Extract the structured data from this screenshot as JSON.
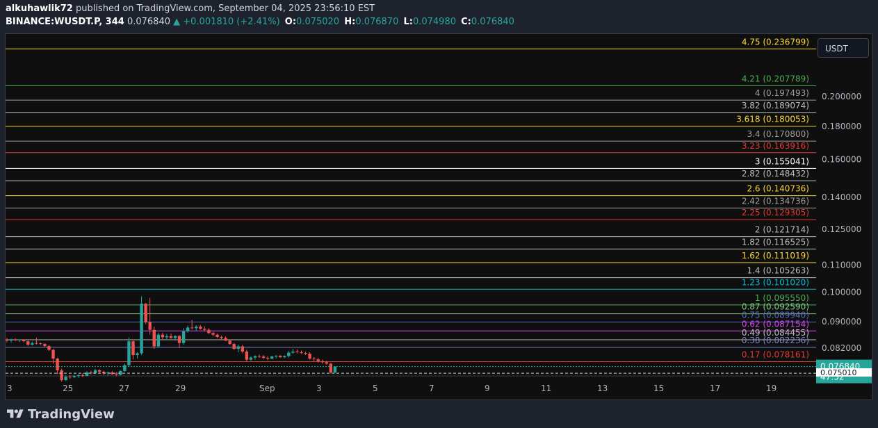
{
  "header": {
    "user": "alkuhawlik72",
    "published": " published on TradingView.com, September 04, 2025 23:56:10 EST",
    "symbol": "BINANCE:WUSDT.P, 344",
    "price": "0.076840",
    "change": "▲ +0.001810 (+2.41%)",
    "o_label": "O:",
    "o_value": "0.075020",
    "h_label": "H:",
    "h_value": "0.076870",
    "l_label": "L:",
    "l_value": "0.074980",
    "c_label": "C:",
    "c_value": "0.076840"
  },
  "currency_button": "USDT",
  "footer": {
    "brand": "TradingView"
  },
  "chart_data": {
    "type": "candlestick",
    "price_scale_labels": [
      "0.200000",
      "0.180000",
      "0.160000",
      "0.140000",
      "0.125000",
      "0.110000",
      "0.100000",
      "0.090000",
      "0.082000"
    ],
    "current_price_label": "0.076840",
    "countdown_label": "47:52",
    "low_marker_label": "0.075010",
    "x_tick_labels": [
      "3",
      "25",
      "27",
      "29",
      "Sep",
      "3",
      "5",
      "7",
      "9",
      "11",
      "13",
      "15",
      "17",
      "19"
    ],
    "fib_levels": [
      {
        "label": "4.75 (0.236799)",
        "value": 0.236799,
        "color": "#fdd835"
      },
      {
        "label": "4.21 (0.207789)",
        "value": 0.207789,
        "color": "#4caf50"
      },
      {
        "label": "4 (0.197493)",
        "value": 0.197493,
        "color": "#9e9e9e"
      },
      {
        "label": "3.82 (0.189074)",
        "value": 0.189074,
        "color": "#bdbdbd"
      },
      {
        "label": "3.618 (0.180053)",
        "value": 0.180053,
        "color": "#fdd835"
      },
      {
        "label": "3.4 (0.170800)",
        "value": 0.1708,
        "color": "#9e9e9e"
      },
      {
        "label": "3.23 (0.163916)",
        "value": 0.163916,
        "color": "#e53935"
      },
      {
        "label": "3 (0.155041)",
        "value": 0.155041,
        "color": "#ffffff"
      },
      {
        "label": "2.82 (0.148432)",
        "value": 0.148432,
        "color": "#bdbdbd"
      },
      {
        "label": "2.6 (0.140736)",
        "value": 0.140736,
        "color": "#fdd835"
      },
      {
        "label": "2.42 (0.134736)",
        "value": 0.134736,
        "color": "#9e9e9e"
      },
      {
        "label": "2.25 (0.129305)",
        "value": 0.129305,
        "color": "#e53935"
      },
      {
        "label": "2 (0.121714)",
        "value": 0.121714,
        "color": "#bdbdbd"
      },
      {
        "label": "1.82 (0.116525)",
        "value": 0.116525,
        "color": "#bdbdbd"
      },
      {
        "label": "1.62 (0.111019)",
        "value": 0.111019,
        "color": "#fdd835"
      },
      {
        "label": "1.4 (0.105263)",
        "value": 0.105263,
        "color": "#bdbdbd"
      },
      {
        "label": "1.23 (0.101020)",
        "value": 0.10102,
        "color": "#00bcd4"
      },
      {
        "label": "1 (0.095550)",
        "value": 0.09555,
        "color": "#4caf50"
      },
      {
        "label": "0.87 (0.092590)",
        "value": 0.09259,
        "color": "#81c784"
      },
      {
        "label": "0.75 (0.089940)",
        "value": 0.08994,
        "color": "#5c6bc0"
      },
      {
        "label": "0.62 (0.087154)",
        "value": 0.087154,
        "color": "#e040fb"
      },
      {
        "label": "0.49 (0.084455)",
        "value": 0.084455,
        "color": "#bdbdbd"
      },
      {
        "label": "0.38 (0.082236)",
        "value": 0.082236,
        "color": "#7986cb"
      },
      {
        "label": "0.17 (0.078161)",
        "value": 0.078161,
        "color": "#e53935"
      }
    ],
    "candles": [
      [
        0.0845,
        0.085,
        0.0837,
        0.0842
      ],
      [
        0.0842,
        0.0848,
        0.0836,
        0.0846
      ],
      [
        0.0846,
        0.0849,
        0.084,
        0.0843
      ],
      [
        0.0843,
        0.0846,
        0.0838,
        0.0845
      ],
      [
        0.0845,
        0.0847,
        0.0837,
        0.084
      ],
      [
        0.084,
        0.0842,
        0.0826,
        0.083
      ],
      [
        0.083,
        0.0839,
        0.0828,
        0.0835
      ],
      [
        0.0835,
        0.0851,
        0.083,
        0.0834
      ],
      [
        0.0834,
        0.0836,
        0.0829,
        0.0832
      ],
      [
        0.0832,
        0.0834,
        0.0824,
        0.0826
      ],
      [
        0.0826,
        0.0829,
        0.0812,
        0.0815
      ],
      [
        0.0815,
        0.0818,
        0.0776,
        0.079
      ],
      [
        0.079,
        0.0792,
        0.0748,
        0.0758
      ],
      [
        0.0758,
        0.0762,
        0.0728,
        0.0732
      ],
      [
        0.0732,
        0.0744,
        0.073,
        0.0741
      ],
      [
        0.0741,
        0.0745,
        0.0735,
        0.074
      ],
      [
        0.074,
        0.0746,
        0.0737,
        0.0743
      ],
      [
        0.0743,
        0.0747,
        0.0738,
        0.0745
      ],
      [
        0.0745,
        0.075,
        0.074,
        0.0743
      ],
      [
        0.0743,
        0.0756,
        0.0742,
        0.0752
      ],
      [
        0.0752,
        0.0757,
        0.0747,
        0.075
      ],
      [
        0.075,
        0.0762,
        0.0748,
        0.0758
      ],
      [
        0.0758,
        0.0761,
        0.075,
        0.0754
      ],
      [
        0.0754,
        0.0757,
        0.0746,
        0.075
      ],
      [
        0.075,
        0.0754,
        0.0744,
        0.0752
      ],
      [
        0.0752,
        0.0756,
        0.0745,
        0.0748
      ],
      [
        0.0748,
        0.0753,
        0.0742,
        0.0746
      ],
      [
        0.0746,
        0.0758,
        0.0744,
        0.0756
      ],
      [
        0.0756,
        0.0776,
        0.0754,
        0.0772
      ],
      [
        0.0772,
        0.0852,
        0.0768,
        0.084
      ],
      [
        0.084,
        0.0842,
        0.0788,
        0.08
      ],
      [
        0.08,
        0.0808,
        0.079,
        0.0805
      ],
      [
        0.0805,
        0.0985,
        0.08,
        0.096
      ],
      [
        0.096,
        0.0962,
        0.0893,
        0.09
      ],
      [
        0.09,
        0.098,
        0.086,
        0.0875
      ],
      [
        0.0875,
        0.0885,
        0.0818,
        0.0825
      ],
      [
        0.0825,
        0.0866,
        0.0821,
        0.086
      ],
      [
        0.086,
        0.0866,
        0.0845,
        0.0852
      ],
      [
        0.0852,
        0.0862,
        0.0843,
        0.0855
      ],
      [
        0.0855,
        0.0863,
        0.0848,
        0.085
      ],
      [
        0.085,
        0.0858,
        0.0842,
        0.0856
      ],
      [
        0.0856,
        0.0859,
        0.082,
        0.0835
      ],
      [
        0.0835,
        0.088,
        0.083,
        0.087
      ],
      [
        0.087,
        0.0888,
        0.0866,
        0.0882
      ],
      [
        0.0882,
        0.0906,
        0.0876,
        0.088
      ],
      [
        0.088,
        0.0889,
        0.0872,
        0.0885
      ],
      [
        0.0885,
        0.089,
        0.0876,
        0.0878
      ],
      [
        0.0878,
        0.0886,
        0.087,
        0.0875
      ],
      [
        0.0875,
        0.088,
        0.0862,
        0.0865
      ],
      [
        0.0865,
        0.0869,
        0.0855,
        0.086
      ],
      [
        0.086,
        0.0863,
        0.085,
        0.0853
      ],
      [
        0.0853,
        0.0857,
        0.0846,
        0.085
      ],
      [
        0.085,
        0.0855,
        0.084,
        0.0842
      ],
      [
        0.0842,
        0.0846,
        0.083,
        0.0832
      ],
      [
        0.0832,
        0.0835,
        0.0815,
        0.0818
      ],
      [
        0.0818,
        0.083,
        0.0808,
        0.0825
      ],
      [
        0.0825,
        0.083,
        0.0805,
        0.081
      ],
      [
        0.081,
        0.0815,
        0.0782,
        0.0787
      ],
      [
        0.0787,
        0.0796,
        0.0784,
        0.0793
      ],
      [
        0.0793,
        0.0799,
        0.0787,
        0.0797
      ],
      [
        0.0797,
        0.0802,
        0.0792,
        0.0796
      ],
      [
        0.0796,
        0.08,
        0.0789,
        0.0792
      ],
      [
        0.0792,
        0.0797,
        0.0786,
        0.079
      ],
      [
        0.079,
        0.0798,
        0.0788,
        0.0796
      ],
      [
        0.0796,
        0.08,
        0.0791,
        0.0798
      ],
      [
        0.0798,
        0.08,
        0.0792,
        0.0794
      ],
      [
        0.0794,
        0.0799,
        0.0791,
        0.0797
      ],
      [
        0.0797,
        0.0812,
        0.0793,
        0.0807
      ],
      [
        0.0807,
        0.0818,
        0.0803,
        0.081
      ],
      [
        0.081,
        0.0816,
        0.0805,
        0.0808
      ],
      [
        0.0808,
        0.0813,
        0.0803,
        0.0806
      ],
      [
        0.0806,
        0.081,
        0.08,
        0.0804
      ],
      [
        0.0804,
        0.0808,
        0.0787,
        0.079
      ],
      [
        0.079,
        0.0794,
        0.0783,
        0.0788
      ],
      [
        0.0788,
        0.0792,
        0.0779,
        0.0783
      ],
      [
        0.0783,
        0.0787,
        0.0776,
        0.078
      ],
      [
        0.078,
        0.0784,
        0.0773,
        0.0776
      ],
      [
        0.0776,
        0.0778,
        0.075,
        0.0752
      ],
      [
        0.0752,
        0.0769,
        0.075,
        0.0768
      ]
    ]
  }
}
